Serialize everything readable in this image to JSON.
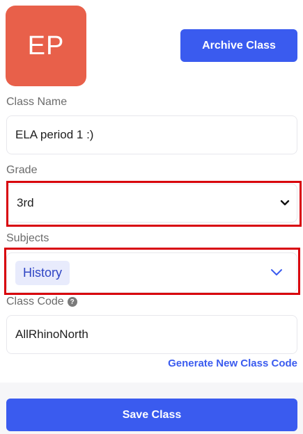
{
  "avatar": {
    "initials": "EP",
    "color": "#e8604a"
  },
  "archive_button": {
    "label": "Archive Class"
  },
  "class_name": {
    "label": "Class Name",
    "value": "ELA period 1 :)"
  },
  "grade": {
    "label": "Grade",
    "value": "3rd"
  },
  "subjects": {
    "label": "Subjects",
    "selected": [
      "History"
    ]
  },
  "class_code": {
    "label": "Class Code",
    "help_icon": "question-circle-icon",
    "value": "AllRhinoNorth"
  },
  "generate_link": {
    "label": "Generate New Class Code"
  },
  "save_button": {
    "label": "Save Class"
  },
  "colors": {
    "primary": "#3a5bef",
    "highlight": "#d8000b",
    "chip_bg": "#e8ebfc",
    "chip_text": "#2f45c4",
    "link": "#3a5bef"
  }
}
